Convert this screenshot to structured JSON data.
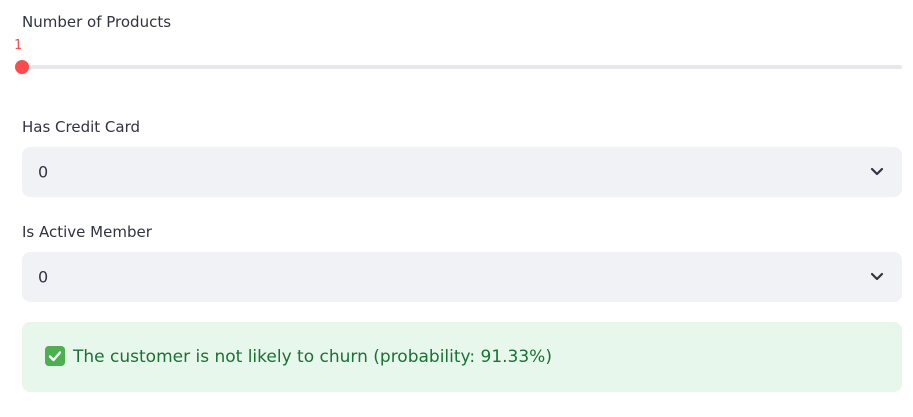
{
  "num_products": {
    "label": "Number of Products",
    "value": "1",
    "fill_fraction": 0.0
  },
  "has_credit_card": {
    "label": "Has Credit Card",
    "selected": "0"
  },
  "is_active_member": {
    "label": "Is Active Member",
    "selected": "0"
  },
  "result": {
    "message": "The customer is not likely to churn (probability: 91.33%)",
    "icon": "check-mark-icon"
  },
  "colors": {
    "accent": "#ff4b4b",
    "success_bg": "#e8f7ec",
    "success_text": "#177233",
    "select_bg": "#f0f2f6"
  }
}
